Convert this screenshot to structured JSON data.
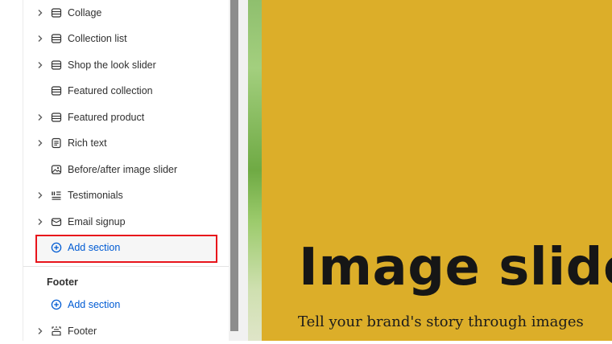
{
  "sidebar": {
    "sections": [
      {
        "label": "Collage",
        "icon": "section-layout-icon",
        "expandable": true
      },
      {
        "label": "Collection list",
        "icon": "section-layout-icon",
        "expandable": true
      },
      {
        "label": "Shop the look slider",
        "icon": "section-layout-icon",
        "expandable": true
      },
      {
        "label": "Featured collection",
        "icon": "section-layout-icon",
        "expandable": false
      },
      {
        "label": "Featured product",
        "icon": "section-layout-icon",
        "expandable": true
      },
      {
        "label": "Rich text",
        "icon": "text-block-icon",
        "expandable": true
      },
      {
        "label": "Before/after image slider",
        "icon": "image-icon",
        "expandable": false
      },
      {
        "label": "Testimonials",
        "icon": "list-icon",
        "expandable": true
      },
      {
        "label": "Email signup",
        "icon": "envelope-icon",
        "expandable": true
      }
    ],
    "add_section_label": "Add section",
    "footer_group": {
      "title": "Footer",
      "add_section_label": "Add section",
      "items": [
        {
          "label": "Footer",
          "icon": "footer-layout-icon",
          "expandable": true
        }
      ]
    }
  },
  "preview": {
    "heading": "Image slide",
    "subheading": "Tell your brand's story through images"
  },
  "colors": {
    "accent_link": "#005bd3",
    "highlight_border": "#e8141b",
    "slide_background": "#dcae29"
  }
}
